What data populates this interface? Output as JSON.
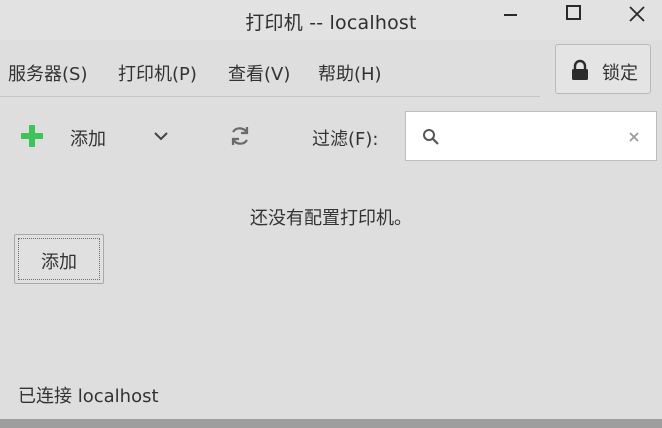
{
  "window": {
    "title": "打印机 -- localhost"
  },
  "menubar": {
    "items": [
      {
        "label": "服务器(S)"
      },
      {
        "label": "打印机(P)"
      },
      {
        "label": "查看(V)"
      },
      {
        "label": "帮助(H)"
      }
    ],
    "lock_label": "锁定"
  },
  "toolbar": {
    "add_label": "添加",
    "filter_label": "过滤(F):",
    "search_value": "",
    "icons": {
      "add": "plus-icon",
      "dropdown": "chevron-down-icon",
      "refresh": "refresh-icon",
      "search": "search-icon",
      "clear": "clear-icon",
      "lock": "lock-icon"
    }
  },
  "content": {
    "empty_message": "还没有配置打印机。",
    "add_button_label": "添加"
  },
  "status": {
    "text": "已连接 localhost"
  },
  "colors": {
    "accent_green": "#3cc45a",
    "background": "#dedede"
  }
}
